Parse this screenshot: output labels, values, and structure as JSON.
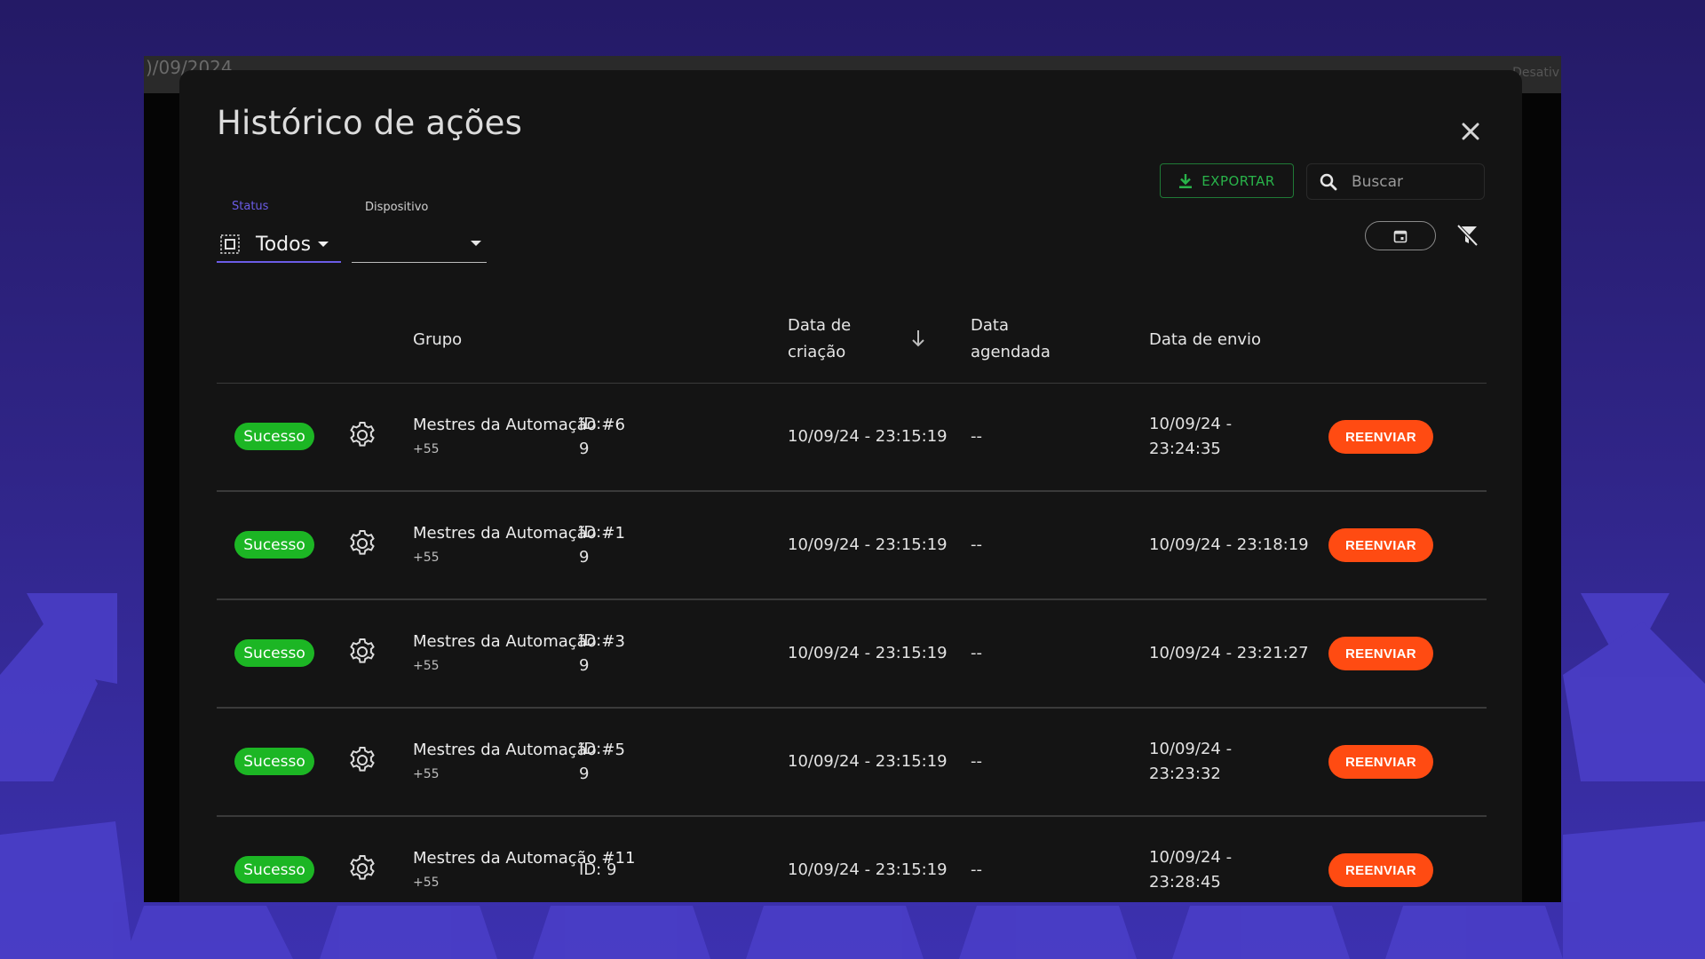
{
  "modal": {
    "title": "Histórico de ações",
    "export_label": "EXPORTAR",
    "search_placeholder": "Buscar"
  },
  "background_window": {
    "partial_date_text": ")/09/2024",
    "partial_right_text": "Desativ"
  },
  "filters": {
    "status_label": "Status",
    "status_value": "Todos",
    "device_label": "Dispositivo",
    "device_value": ""
  },
  "table": {
    "headers": {
      "group": "Grupo",
      "created_line1": "Data de",
      "created_line2": "criação",
      "scheduled_line1": "Data",
      "scheduled_line2": "agendada",
      "sent": "Data de envio"
    },
    "rows": [
      {
        "status": "Sucesso",
        "group": "Mestres da Automação #6",
        "sub": "+55",
        "id_line1": "ID:",
        "id_line2": "9",
        "created": "10/09/24 - 23:15:19",
        "scheduled": "--",
        "sent_line1": "10/09/24 -",
        "sent_line2": "23:24:35",
        "action": "REENVIAR"
      },
      {
        "status": "Sucesso",
        "group": "Mestres da Automação #1",
        "sub": "+55",
        "id_line1": "ID:",
        "id_line2": "9",
        "created": "10/09/24 - 23:15:19",
        "scheduled": "--",
        "sent_line1": "10/09/24 - 23:18:19",
        "sent_line2": "",
        "action": "REENVIAR"
      },
      {
        "status": "Sucesso",
        "group": "Mestres da Automação #3",
        "sub": "+55",
        "id_line1": "ID:",
        "id_line2": "9",
        "created": "10/09/24 - 23:15:19",
        "scheduled": "--",
        "sent_line1": "10/09/24 - 23:21:27",
        "sent_line2": "",
        "action": "REENVIAR"
      },
      {
        "status": "Sucesso",
        "group": "Mestres da Automação #5",
        "sub": "+55",
        "id_line1": "ID:",
        "id_line2": "9",
        "created": "10/09/24 - 23:15:19",
        "scheduled": "--",
        "sent_line1": "10/09/24 -",
        "sent_line2": "23:23:32",
        "action": "REENVIAR"
      },
      {
        "status": "Sucesso",
        "group": "Mestres da Automação #11",
        "sub": "+55",
        "id_line1": "ID: 9",
        "id_line2": "",
        "created": "10/09/24 - 23:15:19",
        "scheduled": "--",
        "sent_line1": "10/09/24 -",
        "sent_line2": "23:28:45",
        "action": "REENVIAR"
      }
    ]
  },
  "icons": {
    "close": "close-icon",
    "export": "download-icon",
    "search": "search-icon",
    "status_select": "select-all-icon",
    "calendar": "calendar-icon",
    "filter_clear": "filter-off-icon",
    "sort": "arrow-down-icon",
    "row_gear": "gear-icon"
  },
  "colors": {
    "background": "#2f2485",
    "modal": "#141414",
    "success": "#1cb624",
    "resend": "#ff4b12",
    "accent": "#6b5ce6",
    "export": "#29b34a"
  }
}
